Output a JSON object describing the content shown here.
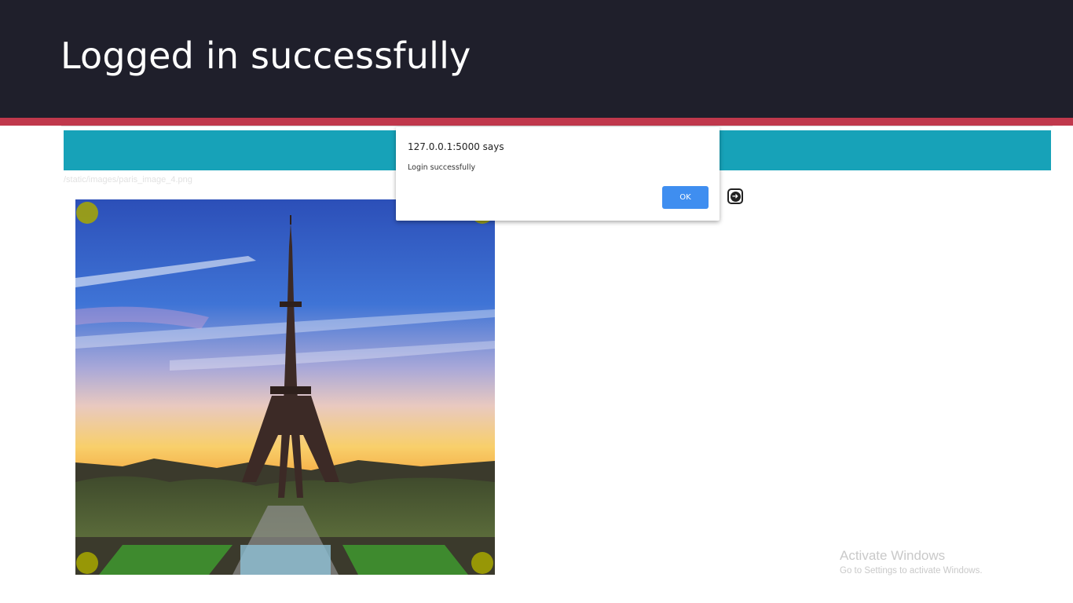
{
  "slide": {
    "title": "Logged in successfully",
    "header_bg": "#1f1f2b",
    "accent_color": "#c0384c"
  },
  "app": {
    "header_color": "#17a2b8",
    "image_path": "/static/images/paris_image_4.png",
    "next_icon": "arrow-right-circle-icon",
    "image_description_icon": "eiffel-tower-photo"
  },
  "alert": {
    "title": "127.0.0.1:5000 says",
    "message": "Login successfully",
    "ok_label": "OK",
    "ok_color": "#3f8ef0"
  },
  "watermark": {
    "title": "Activate Windows",
    "subtitle": "Go to Settings to activate Windows."
  }
}
